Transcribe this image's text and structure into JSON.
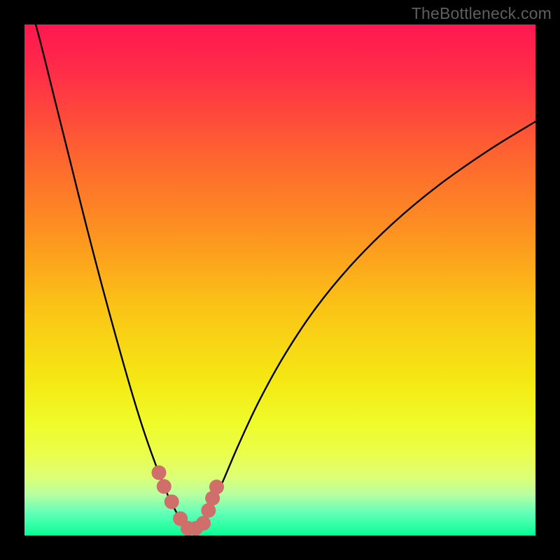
{
  "watermark": "TheBottleneck.com",
  "colors": {
    "frame": "#000000",
    "watermark": "#5f5f5f",
    "curve": "#000000",
    "marker": "#cf6e6b",
    "gradient_stops": [
      {
        "offset": 0.0,
        "color": "#ff1750"
      },
      {
        "offset": 0.1,
        "color": "#ff2f47"
      },
      {
        "offset": 0.25,
        "color": "#fe6231"
      },
      {
        "offset": 0.4,
        "color": "#fd9021"
      },
      {
        "offset": 0.55,
        "color": "#fbc316"
      },
      {
        "offset": 0.7,
        "color": "#f4e914"
      },
      {
        "offset": 0.78,
        "color": "#effb2a"
      },
      {
        "offset": 0.84,
        "color": "#eafe4c"
      },
      {
        "offset": 0.885,
        "color": "#ddff75"
      },
      {
        "offset": 0.92,
        "color": "#b7ffa0"
      },
      {
        "offset": 0.955,
        "color": "#64ffb8"
      },
      {
        "offset": 1.0,
        "color": "#07ff95"
      }
    ]
  },
  "chart_data": {
    "type": "line",
    "title": "",
    "xlabel": "",
    "ylabel": "",
    "xlim": [
      0,
      100
    ],
    "ylim": [
      0,
      100
    ],
    "series": [
      {
        "name": "bottleneck-curve",
        "x": [
          0,
          3,
          6,
          9,
          12,
          15,
          18,
          21,
          23.5,
          26,
          28,
          30,
          31,
          32,
          33,
          34,
          35.5,
          37,
          39,
          42,
          46,
          51,
          57,
          64,
          72,
          81,
          91,
          100
        ],
        "y": [
          108,
          97,
          85,
          73,
          61,
          49.5,
          38.5,
          28,
          20,
          13,
          8,
          4,
          2.2,
          1.3,
          1.2,
          1.6,
          3,
          6.5,
          11,
          18,
          26.5,
          35.5,
          44.5,
          53,
          61,
          68.5,
          75.5,
          81
        ]
      }
    ],
    "markers": {
      "name": "highlighted-segment",
      "x": [
        26.3,
        27.3,
        28.8,
        30.5,
        32.0,
        33.5,
        35.0,
        36.0,
        36.8,
        37.6
      ],
      "y": [
        12.3,
        9.6,
        6.6,
        3.3,
        1.4,
        1.4,
        2.4,
        4.9,
        7.3,
        9.5
      ]
    }
  }
}
